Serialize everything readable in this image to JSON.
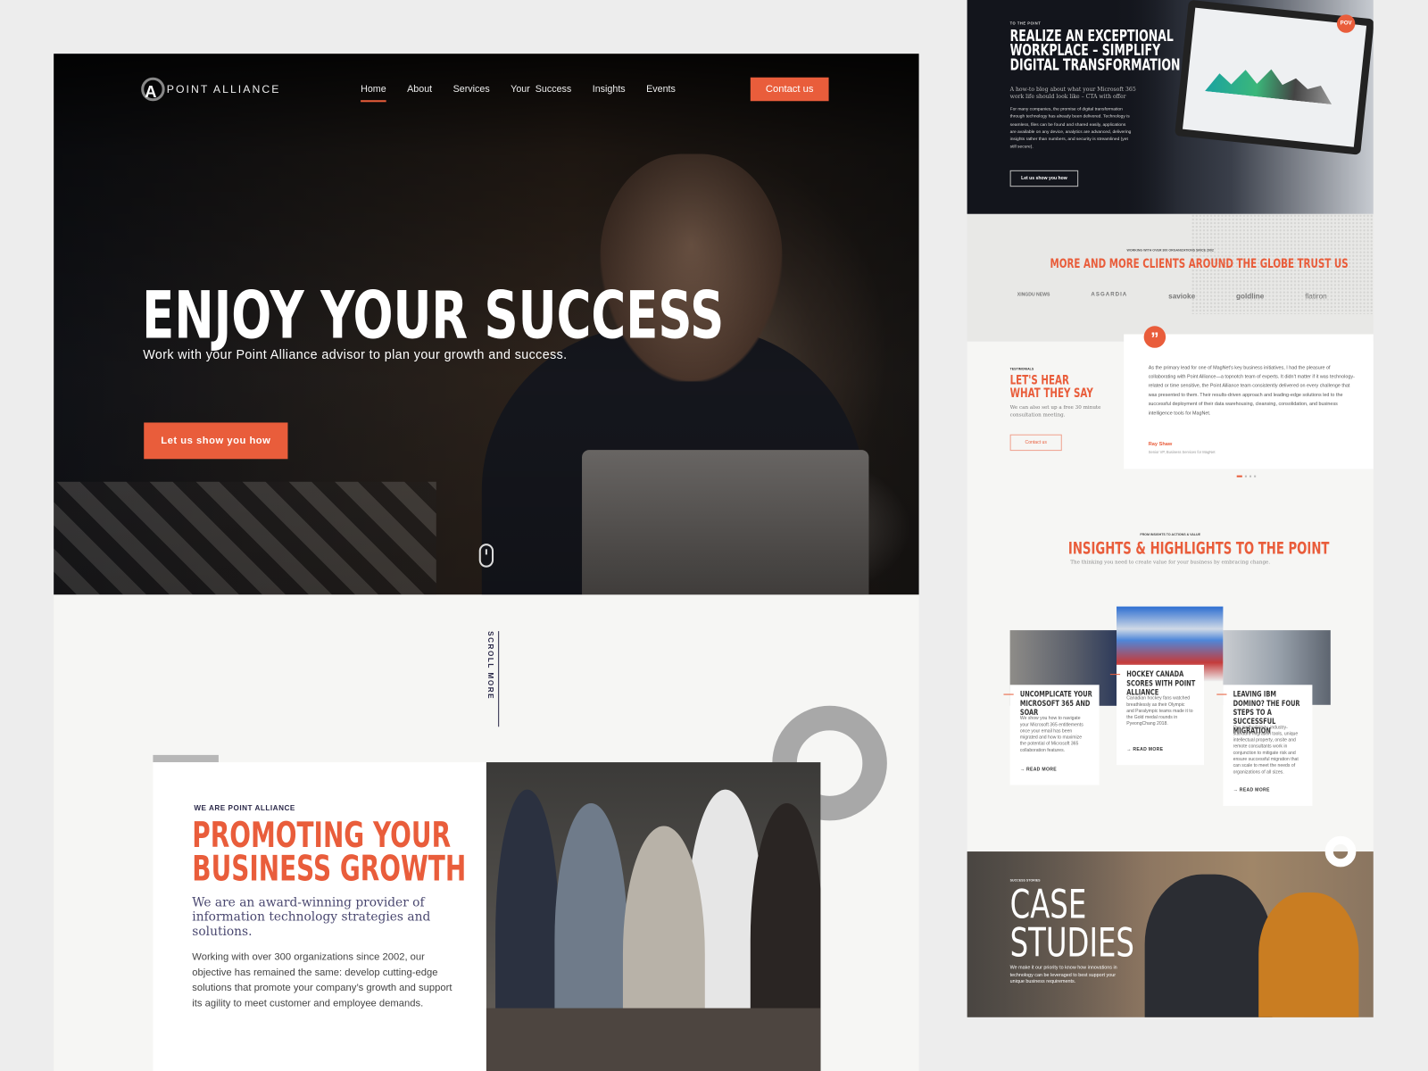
{
  "brand": {
    "name": "POINT ALLIANCE",
    "accent": "#e95d3b",
    "navy": "#2c2a4a"
  },
  "nav": {
    "items": [
      {
        "label": "Home",
        "active": true
      },
      {
        "label": "About"
      },
      {
        "label": "Services"
      },
      {
        "label": "Your  Success"
      },
      {
        "label": "Insights"
      },
      {
        "label": "Events"
      }
    ],
    "cta": "Contact us"
  },
  "hero": {
    "title": "ENJOY YOUR SUCCESS",
    "subtitle": "Work with your Point Alliance advisor to plan your growth and success.",
    "cta": "Let us show you how",
    "scroll_icon": "mouse-icon"
  },
  "scroll_more": "SCROLL MORE",
  "about": {
    "eyebrow": "WE ARE POINT ALLIANCE",
    "title_line1": "PROMOTING YOUR",
    "title_line2": "BUSINESS GROWTH",
    "lead": "We are an award-winning provider of information technology strategies and solutions.",
    "body": "Working with over 300 organizations since 2002, our objective has remained the same: develop cutting-edge solutions that promote your company’s growth and support its agility to meet customer and employee demands."
  },
  "blog": {
    "eyebrow": "TO THE POINT",
    "title_line1": "REALIZE AN EXCEPTIONAL",
    "title_line2": "WORKPLACE – SIMPLIFY",
    "title_line3": "DIGITAL TRANSFORMATION",
    "lead": "A how-to blog about what your Microsoft 365 work life should look like – CTA with offer",
    "body": "For many companies, the promise of digital transformation through technology has already been delivered. Technology is seamless, files can be found and shared easily, applications are available on any device, analytics are advanced, delivering insights rather than numbers, and security is streamlined (yet still secure).",
    "cta": "Let us show you how",
    "badge": "POV"
  },
  "clients": {
    "eyebrow": "WORKING WITH OVER 300 ORGANIZATIONS SINCE 2002",
    "title": "MORE AND MORE CLIENTS AROUND THE GLOBE TRUST US",
    "logos": [
      "XINGDU NEWS",
      "ASGARDIA",
      "savioke",
      "goldline",
      "flatiron"
    ]
  },
  "testimonials": {
    "eyebrow": "TESTIMONIALS",
    "title_line1": "LET'S HEAR",
    "title_line2": "WHAT THEY SAY",
    "lead": "We can also set up a free 30 minute consultation meeting.",
    "cta": "Contact us",
    "quote": "As the primary lead for one of MagNet's key business initiatives, I had the pleasure of collaborating with Point Alliance—a topnotch team of experts. It didn't matter if it was technology-related or time sensitive, the Point Alliance team consistently delivered on every challenge that was presented to them. Their results-driven approach and leading-edge solutions led to the successful deployment of their data warehousing, cleansing, consolidation, and business intelligence tools for MagNet.",
    "author": "Ray Shaw",
    "role": "Senior VP, Business Services for MagNet",
    "pager_active": 1,
    "pager_count": 4
  },
  "insights": {
    "eyebrow": "FROM INSIGHTS TO ACTIONS & VALUE",
    "title": "INSIGHTS & HIGHLIGHTS TO THE POINT",
    "subtitle": "The thinking you need to create value for your business by embracing change.",
    "read_more": "READ MORE",
    "cards": [
      {
        "title": "UNCOMPLICATE YOUR MICROSOFT 365 AND SOAR",
        "text": "We show you how to navigate your Microsoft 365 entitlements once your email has been migrated and how to maximize the potential of Microsoft 365 collaboration features."
      },
      {
        "title": "HOCKEY CANADA SCORES WITH POINT ALLIANCE",
        "text": "Canadian hockey fans watched breathlessly as their Olympic and Paralympic teams made it to the Gold medal rounds in PyeongChang 2018."
      },
      {
        "title": "LEAVING IBM DOMINO? THE FOUR STEPS TO A SUCCESSFUL MIGRATION",
        "text": "Our methodology, industry-standard migration tools, unique intellectual property, onsite and remote consultants work in conjunction to mitigate risk and ensure successful migration that can scale to meet the needs of organizations of all sizes."
      }
    ]
  },
  "case_studies": {
    "eyebrow": "SUCCESS STORIES",
    "title_line1": "CASE",
    "title_line2": "STUDIES",
    "body": "We make it our priority to know how innovations in technology can be leveraged to best support your unique business requirements."
  }
}
